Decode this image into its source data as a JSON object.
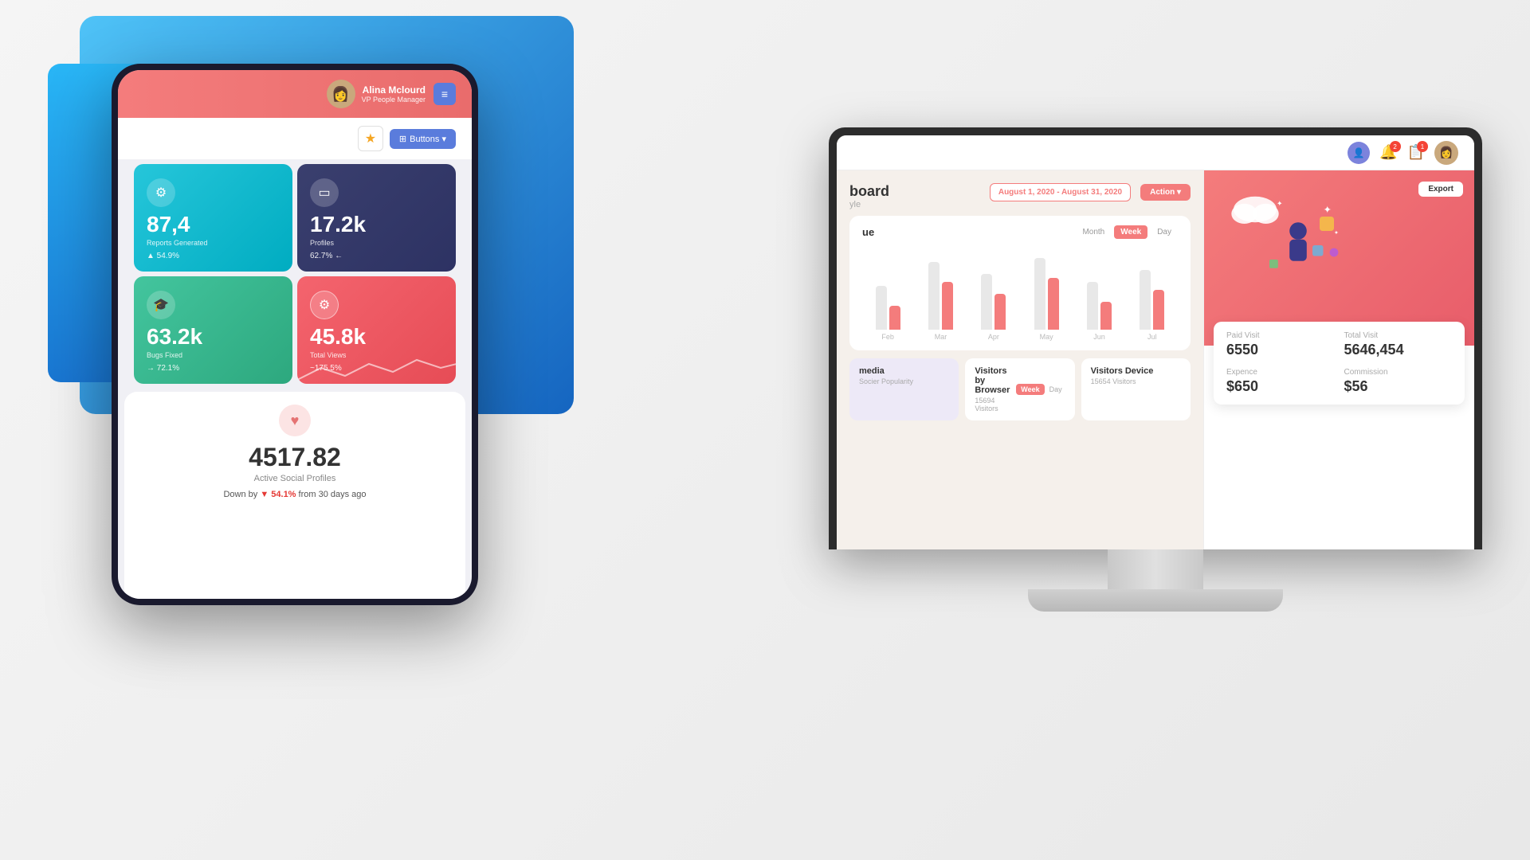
{
  "background": {
    "color": "#f0ede8"
  },
  "tablet": {
    "header": {
      "user_name": "Alina Mclourd",
      "user_role": "VP People Manager"
    },
    "toolbar": {
      "buttons_label": "Buttons ▾"
    },
    "stats": [
      {
        "id": "reports",
        "value": "87,4",
        "label": "Reports Generated",
        "change": "▲ 54.9%",
        "change_type": "up",
        "color": "cyan",
        "icon": "⚙"
      },
      {
        "id": "profiles",
        "value": "17.2k",
        "label": "Profiles",
        "change": "62.7% ←",
        "change_type": "neutral",
        "color": "navy",
        "icon": "▭"
      },
      {
        "id": "bugs",
        "value": "63.2k",
        "label": "Bugs Fixed",
        "change": "→ 72.1%",
        "change_type": "neutral",
        "color": "green",
        "icon": "🎓"
      },
      {
        "id": "views",
        "value": "45.8k",
        "label": "Total Views",
        "change": "~175.5%",
        "change_type": "up",
        "color": "red",
        "icon": "⚙"
      }
    ],
    "bottom": {
      "value": "4517.82",
      "label": "Active Social Profiles",
      "change_text": "Down by",
      "change_value": "▼ 54.1%",
      "change_suffix": "from 30 days ago"
    }
  },
  "monitor": {
    "topbar": {
      "notification_count_1": "2",
      "notification_count_2": "1"
    },
    "dashboard": {
      "title": "board",
      "subtitle": "yle",
      "date_range": "August 1, 2020 - August 31, 2020",
      "action_label": "Action ▾"
    },
    "revenue": {
      "title": "ue",
      "tabs": [
        "Month",
        "Week",
        "Day"
      ],
      "active_tab": "Week",
      "chart_labels": [
        "Feb",
        "Mar",
        "Apr",
        "May",
        "Jun",
        "Jul"
      ],
      "chart_data": [
        {
          "gray": 55,
          "red": 30
        },
        {
          "gray": 85,
          "red": 60
        },
        {
          "gray": 70,
          "red": 45
        },
        {
          "gray": 90,
          "red": 65
        },
        {
          "gray": 60,
          "red": 35
        },
        {
          "gray": 75,
          "red": 50
        }
      ]
    },
    "right_panel": {
      "export_label": "Export",
      "paid_visit_label": "Paid Visit",
      "paid_visit_value": "6550",
      "total_visit_label": "Total Visit",
      "total_visit_value": "5646,454",
      "expence_label": "Expence",
      "expence_value": "$650",
      "commission_label": "Commission",
      "commission_value": "$56"
    },
    "bottom_sections": [
      {
        "id": "social",
        "title": "media",
        "subtitle": "Socier Popularity"
      },
      {
        "id": "browser",
        "title": "Visitors by Browser",
        "subtitle": "15694 Visitors",
        "has_tabs": true,
        "week_label": "Week",
        "day_label": "Day"
      },
      {
        "id": "device",
        "title": "Visitors Device",
        "subtitle": "15654 Visitors"
      }
    ]
  }
}
